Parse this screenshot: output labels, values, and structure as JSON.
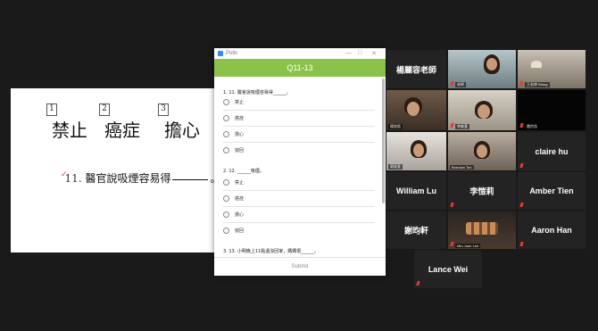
{
  "slide": {
    "items": [
      {
        "num": "1",
        "word": "禁止"
      },
      {
        "num": "2",
        "word": "癌症"
      },
      {
        "num": "3",
        "word": "擔心"
      }
    ],
    "question_num": "11.",
    "question_text": "醫官說吸煙容易得",
    "question_end": "。"
  },
  "polls": {
    "app_title": "Polls",
    "header": "Q11-13",
    "submit_label": "Submit",
    "questions": [
      {
        "title": "1. 11. 醫官說吸煙容易得______。",
        "options": [
          "禁止",
          "癌症",
          "擔心",
          "窗回"
        ]
      },
      {
        "title": "2. 12. ______吸煙。",
        "options": [
          "禁止",
          "癌症",
          "擔心",
          "窗回"
        ]
      },
      {
        "title": "3. 13. 小明晚上11點還沒回家，媽媽很______。"
      }
    ]
  },
  "participants": [
    {
      "name": "楊麗容老師",
      "type": "name"
    },
    {
      "name": "老師",
      "type": "video"
    },
    {
      "name": "王若婷 Wong",
      "type": "video"
    },
    {
      "name": "楊奕銘",
      "type": "video"
    },
    {
      "name": "李敏萱",
      "type": "video"
    },
    {
      "name": "雷詩浩",
      "type": "video"
    },
    {
      "name": "郭銘萱",
      "type": "video"
    },
    {
      "name": "Brandon Tan",
      "type": "video"
    },
    {
      "name": "claire hu",
      "type": "name"
    },
    {
      "name": "William Lu",
      "type": "name"
    },
    {
      "name": "李愷莉",
      "type": "name"
    },
    {
      "name": "Amber Tien",
      "type": "name"
    },
    {
      "name": "謝昀軒",
      "type": "name"
    },
    {
      "name": "Min-Juan Lee",
      "type": "video"
    },
    {
      "name": "Aaron Han",
      "type": "name"
    },
    {
      "name": "Lance Wei",
      "type": "name"
    }
  ],
  "colors": {
    "poll_header": "#8bc34a",
    "mic_muted": "#e53935",
    "zoom_blue": "#2d8cff"
  }
}
